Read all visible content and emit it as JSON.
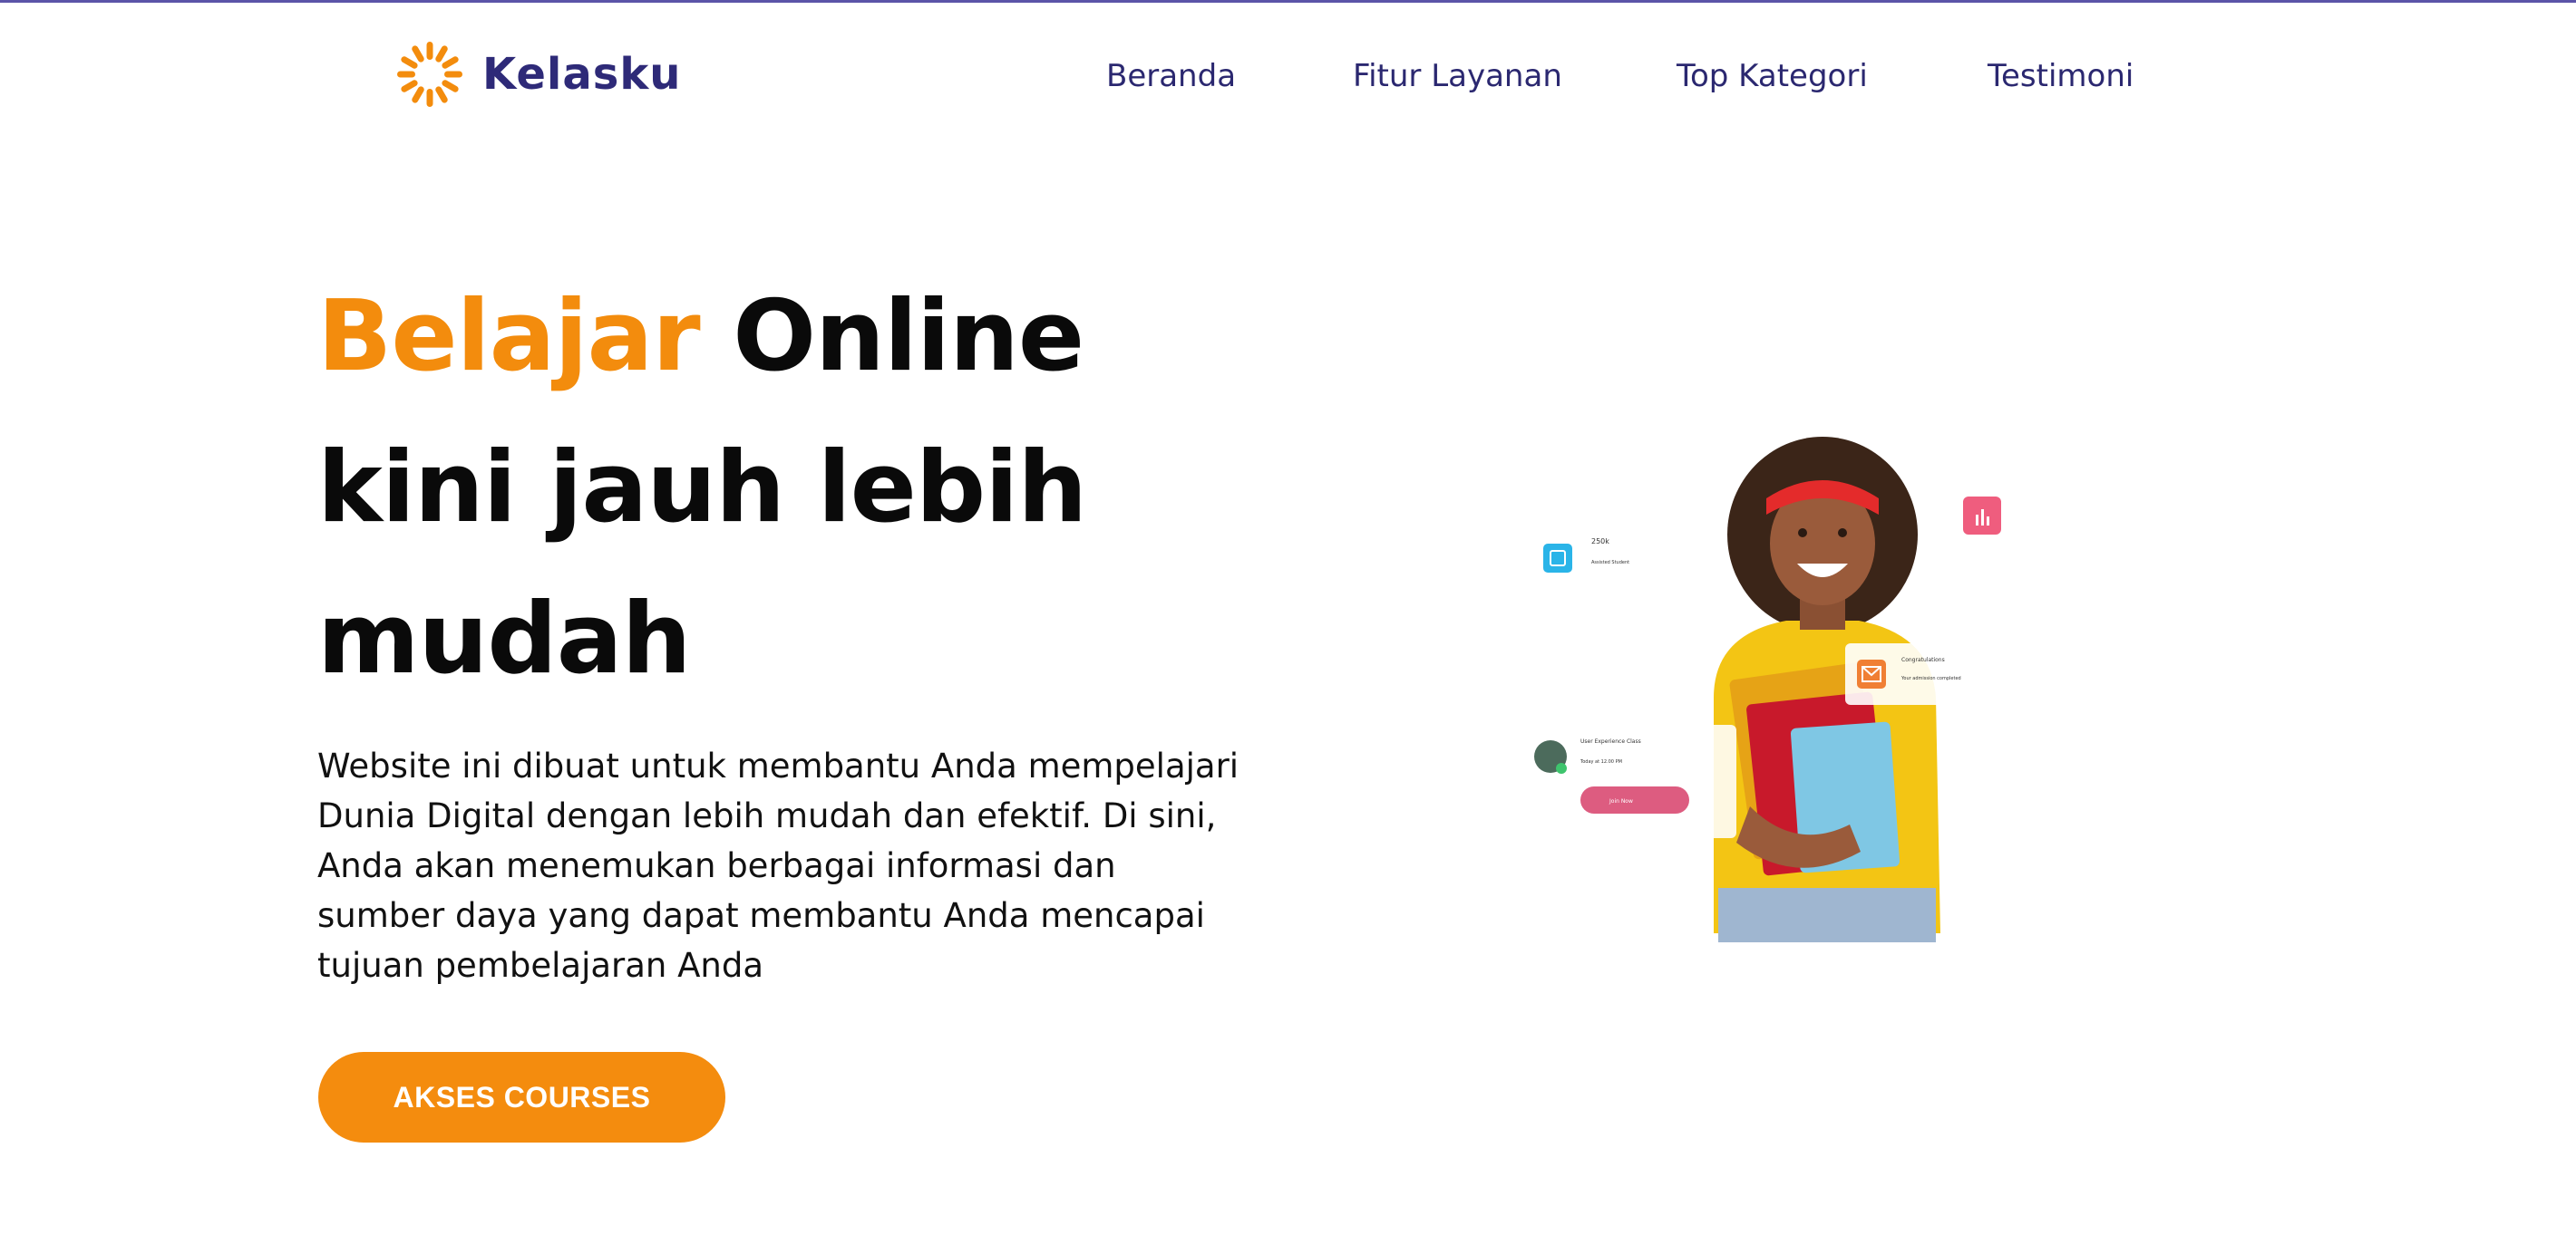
{
  "brand": {
    "name": "Kelasku",
    "logo_icon": "sun-burst-icon",
    "logo_color": "#f38c0d",
    "name_color": "#2e2a78"
  },
  "nav": {
    "items": [
      {
        "label": "Beranda"
      },
      {
        "label": "Fitur Layanan"
      },
      {
        "label": "Top Kategori"
      },
      {
        "label": "Testimoni"
      }
    ],
    "color": "#2b2870"
  },
  "hero": {
    "title_accent": "Belajar",
    "title_rest": "Online",
    "title_line2": "kini jauh lebih",
    "title_line3": "mudah",
    "accent_color": "#f38c0d",
    "description": "Website ini dibuat untuk membantu Anda mempelajari Dunia Digital dengan lebih mudah dan efektif. Di sini, Anda akan menemukan berbagai informasi dan sumber daya yang dapat membantu Anda mencapai tujuan pembelajaran Anda",
    "cta_label": "AKSES COURSES",
    "cta_color": "#f48c0e"
  },
  "illustration": {
    "card_students_value": "250k",
    "card_students_label": "Assisted Student",
    "card_congrats_title": "Congratulations",
    "card_congrats_text": "Your admission completed",
    "card_class_title": "User Experience Class",
    "card_class_time": "Today at 12.00 PM",
    "card_class_button": "Join Now",
    "calendar_icon": "calendar-icon",
    "mail_icon": "mail-icon",
    "chart_icon": "bar-chart-icon"
  }
}
